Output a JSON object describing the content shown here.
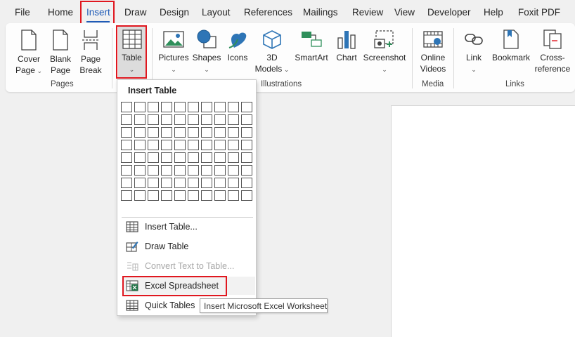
{
  "menu": {
    "tabs": [
      "File",
      "Home",
      "Insert",
      "Draw",
      "Design",
      "Layout",
      "References",
      "Mailings",
      "Review",
      "View",
      "Developer",
      "Help",
      "Foxit PDF"
    ],
    "active": "Insert"
  },
  "ribbon": {
    "pages": {
      "label": "Pages",
      "cover_page": "Cover\nPage",
      "blank_page": "Blank\nPage",
      "page_break": "Page\nBreak"
    },
    "tables": {
      "table": "Table"
    },
    "illustrations": {
      "label": "Illustrations",
      "pictures": "Pictures",
      "shapes": "Shapes",
      "icons": "Icons",
      "models_3d": "3D\nModels",
      "smartart": "SmartArt",
      "chart": "Chart",
      "screenshot": "Screenshot"
    },
    "media": {
      "label": "Media",
      "online_videos": "Online\nVideos"
    },
    "links": {
      "label": "Links",
      "link": "Link",
      "bookmark": "Bookmark",
      "cross_reference": "Cross-\nreference"
    }
  },
  "dropdown": {
    "title": "Insert Table",
    "grid": {
      "columns": 10,
      "rows": 8
    },
    "items": [
      {
        "label": "Insert Table...",
        "icon": "insert-table-icon",
        "disabled": false
      },
      {
        "label": "Draw Table",
        "icon": "draw-table-icon",
        "disabled": false
      },
      {
        "label": "Convert Text to Table...",
        "icon": "convert-text-icon",
        "disabled": true
      },
      {
        "label": "Excel Spreadsheet",
        "icon": "excel-icon",
        "disabled": false
      },
      {
        "label": "Quick Tables",
        "icon": "quick-tables-icon",
        "disabled": false
      }
    ]
  },
  "tooltip": "Insert Microsoft Excel Worksheet",
  "colors": {
    "highlight": "#e0171f",
    "active_underline": "#1f5bb7",
    "excel_green": "#1d7044"
  }
}
